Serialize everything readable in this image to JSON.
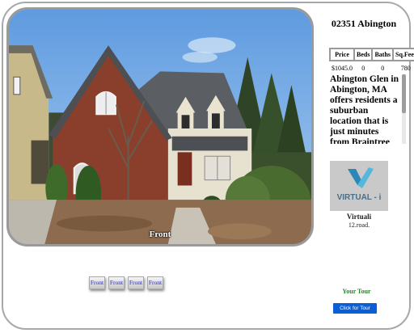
{
  "listing": {
    "title": "02351 Abington",
    "photo_caption": "Front",
    "stats_headers": [
      "Price",
      "Beds",
      "Baths",
      "Sq.Feet"
    ],
    "stats_values": [
      "$1045.0",
      "0",
      "0",
      "780"
    ],
    "description": "Abington Glen in Abington, MA offers residents a suburban location that is just minutes from Braintree and Quincy. We are only a short drive from"
  },
  "logo": {
    "text": "VIRTUAL - i",
    "name": "Virtuali",
    "subtitle": "12.road."
  },
  "thumbnails": [
    "Front",
    "Front",
    "Front",
    "Front"
  ],
  "tour": {
    "label": "Your Tour",
    "button": "Click for Tour"
  },
  "colors": {
    "frame_border": "#a8a8a8",
    "sky": "#7fb1e6",
    "thumb_link": "#1a1aee",
    "tour_label": "#1f8a1f",
    "tour_button": "#0a5fd6",
    "logo_bg": "#c9c9c9",
    "logo_accent": "#2d87b8"
  }
}
